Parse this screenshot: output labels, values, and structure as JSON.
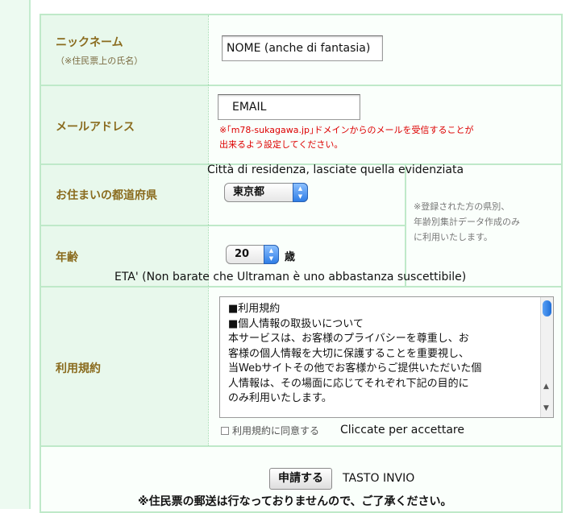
{
  "form": {
    "nickname": {
      "label": "ニックネーム",
      "sublabel": "（※住民票上の氏名）",
      "value": "NOME (anche di fantasia)"
    },
    "email": {
      "label": "メールアドレス",
      "value": "EMAIL",
      "note_line1": "※｢m78-sukagawa.jp｣ドメインからのメールを受信することが",
      "note_line2": "出来るよう設定してください。"
    },
    "prefecture": {
      "label": "お住まいの都道府県",
      "annotation": "Città di residenza, lasciate quella evidenziata",
      "selected": "東京都"
    },
    "side_note": {
      "line1": "※登録された方の県別、",
      "line2": "年齢別集計データ作成のみ",
      "line3": "に利用いたします。"
    },
    "age": {
      "label": "年齢",
      "selected": "20",
      "unit": "歳",
      "annotation": "ETA' (Non barate che Ultraman è uno abbastanza suscettibile)"
    },
    "terms": {
      "label": "利用規約",
      "lines": [
        "■利用規約",
        "■個人情報の取扱いについて",
        "本サービスは、お客様のプライバシーを尊重し、お",
        "客様の個人情報を大切に保護することを重要視し、",
        "当Webサイトその他でお客様からご提供いただいた個",
        "人情報は、その場面に応じてそれぞれ下記の目的に",
        "のみ利用いたします。"
      ],
      "agree_label": "利用規約に同意する",
      "agree_annotation": "Cliccate per accettare",
      "agree_checked": false
    },
    "submit": {
      "label": "申請する",
      "annotation": "TASTO INVIO",
      "notice": "※住民票の郵送は行なっておりませんので、ご了承ください。"
    }
  },
  "colors": {
    "label_text": "#8a6b1e",
    "label_bg": "#e8f8ec",
    "border": "#bfe9c9",
    "warning": "#dd0000"
  }
}
